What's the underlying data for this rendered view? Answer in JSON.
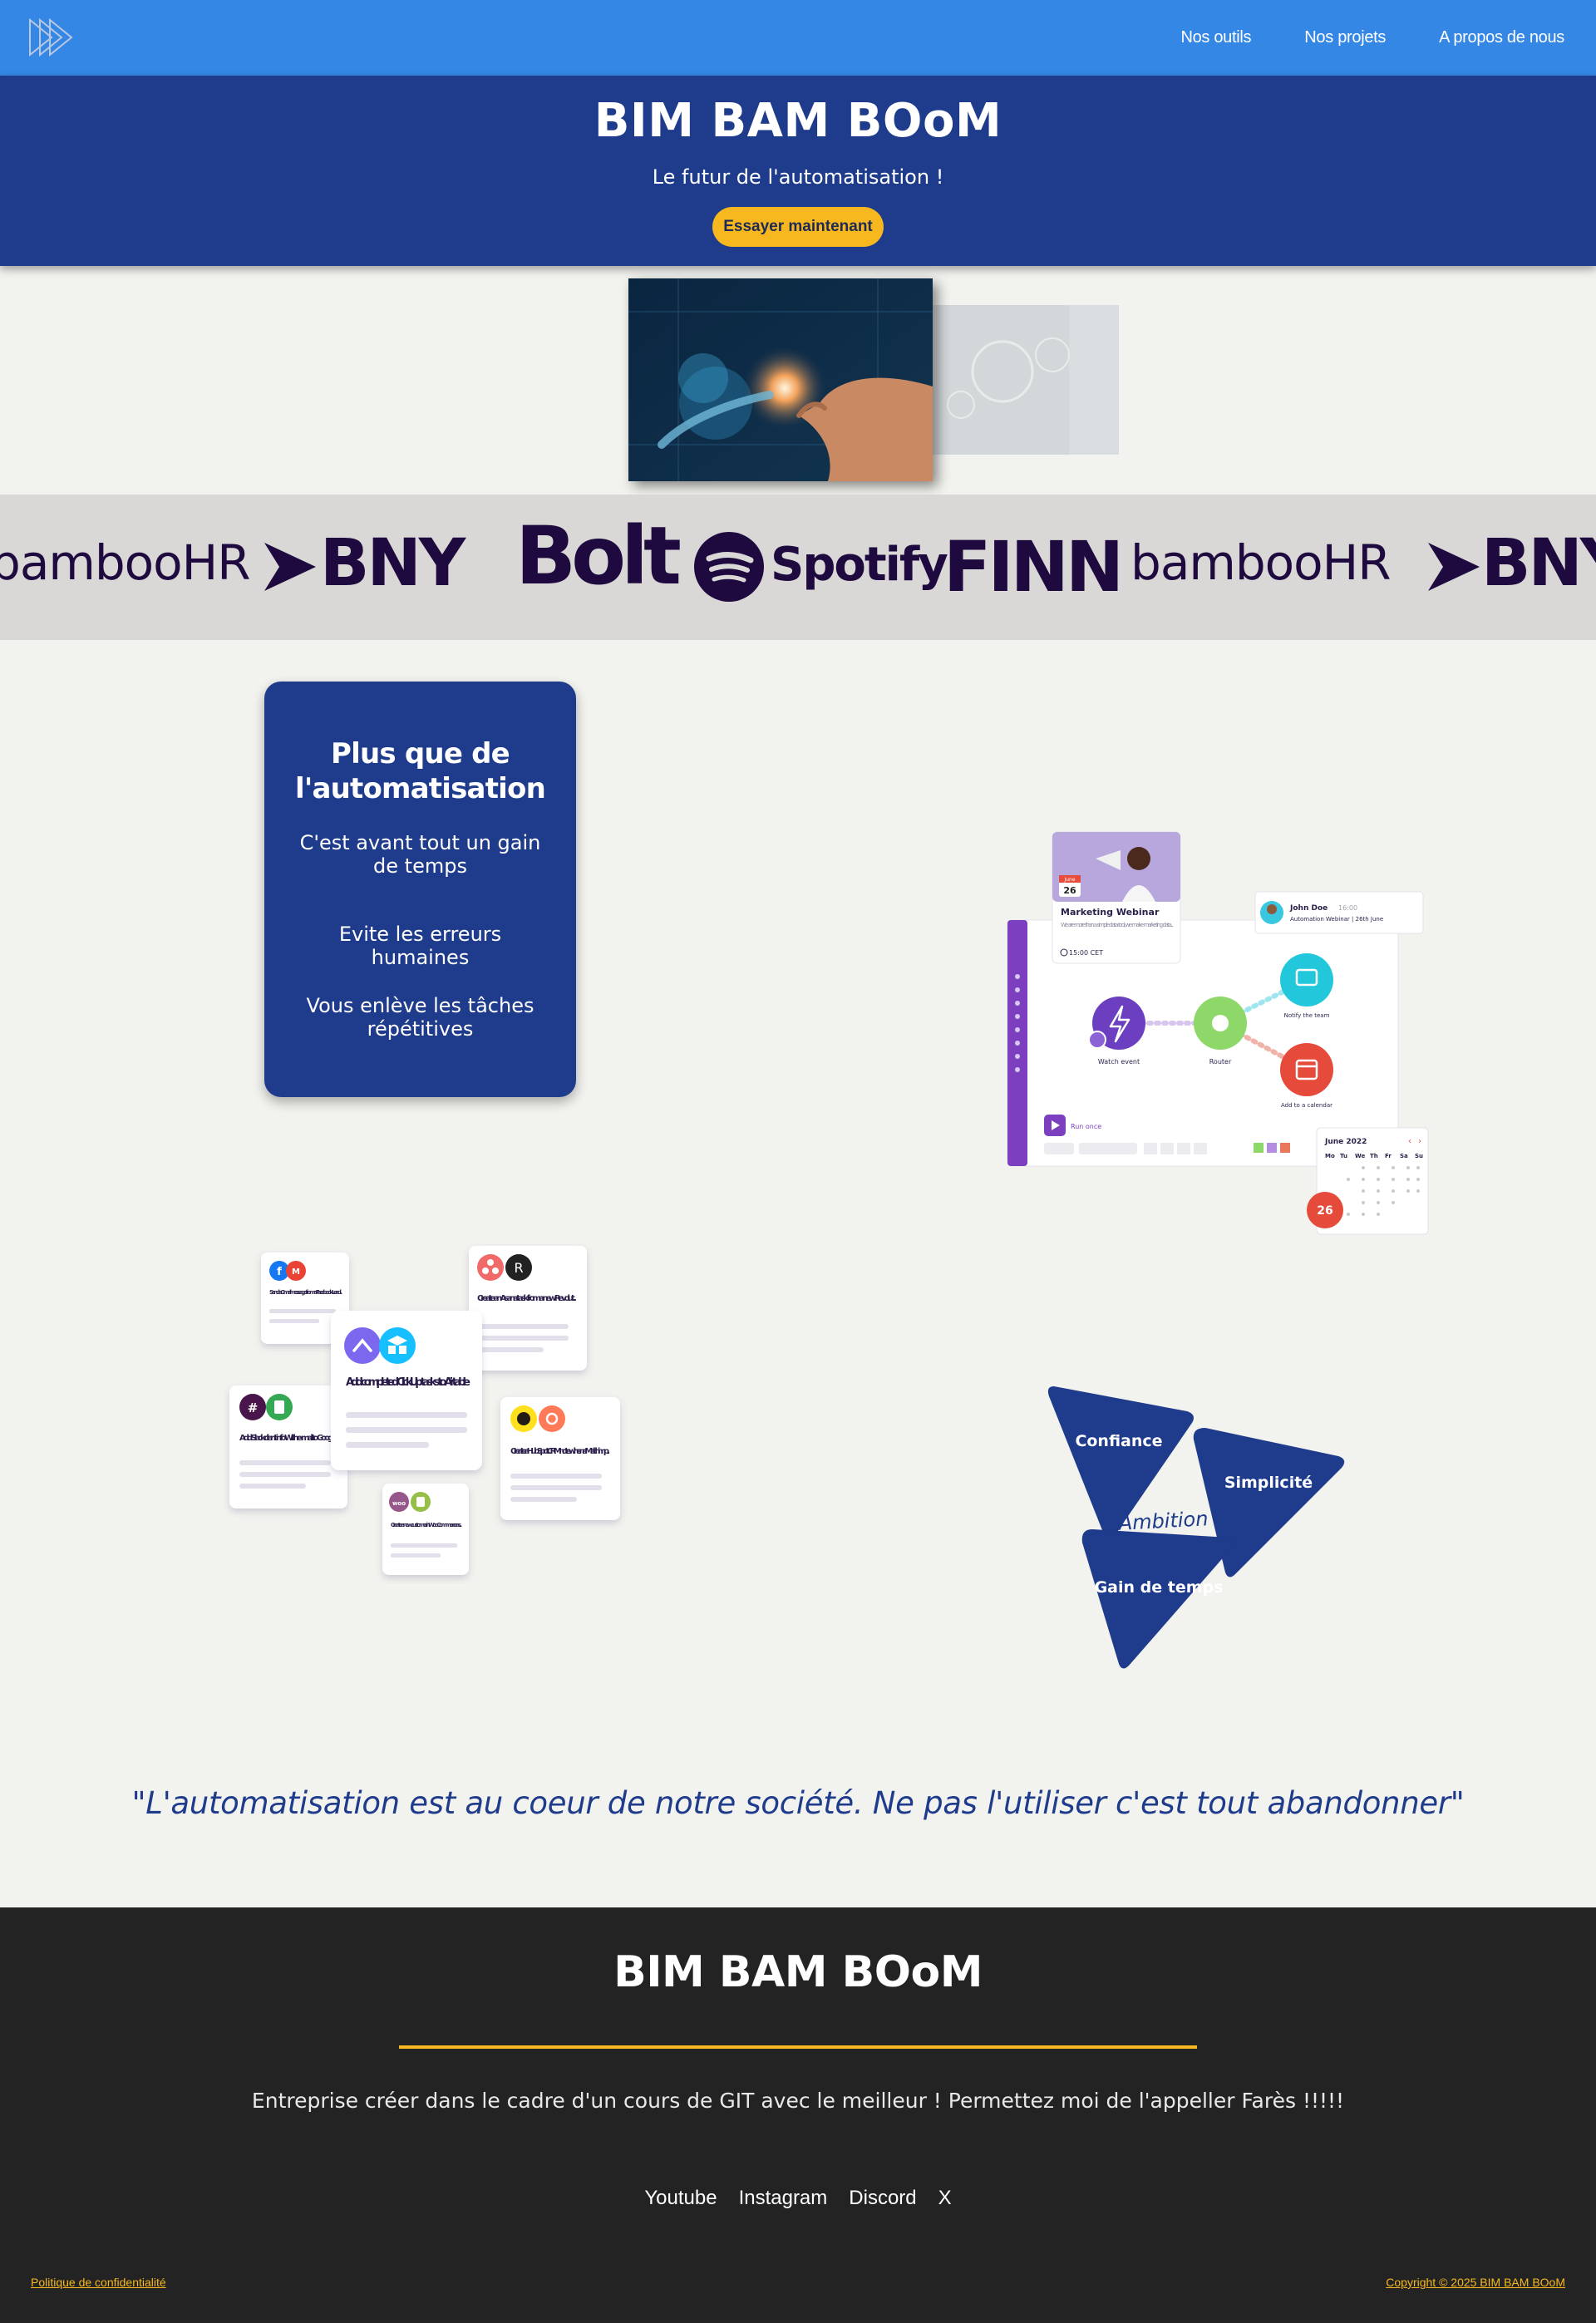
{
  "nav": {
    "links": [
      "Nos outils",
      "Nos projets",
      "A propos de nous"
    ]
  },
  "hero": {
    "title": "BIM BAM BOoM",
    "subtitle": "Le futur de l'automatisation !",
    "cta_label": "Essayer maintenant"
  },
  "brands": [
    "bambooHR",
    "BNY",
    "Bolt",
    "Spotify",
    "FINN"
  ],
  "feature_card": {
    "title": "Plus que de l'automatisation",
    "items": [
      "C'est avant tout un gain de temps",
      "Evite les erreurs humaines",
      "Vous enlève les tâches répétitives"
    ]
  },
  "flow_illustration": {
    "webinar_title": "Marketing Webinar",
    "webinar_text": "We are more than a simple data tool, we make marketing data...",
    "webinar_time": "15:00 CET",
    "webinar_badge_month": "June",
    "webinar_badge_day": "26",
    "contact_name": "John Doe",
    "contact_time": "16:00",
    "contact_detail": "Automation Webinar | 26th June",
    "node_watch": "Watch event",
    "node_router": "Router",
    "node_notify": "Notify the team",
    "node_calendar": "Add to a calendar",
    "run_label": "Run once",
    "calendar_month": "June 2022",
    "calendar_days": [
      "Mo",
      "Tu",
      "We",
      "Th",
      "Fr",
      "Sa",
      "Su"
    ],
    "calendar_selected": "26"
  },
  "cards_illustration": {
    "cards": [
      "Send a Gmail message from a Facebook Lead...",
      "Create an Asana task from a new Revolut...",
      "Add completed ClickUp tasks to Airtable",
      "Add Slack client info With e-mail to Google...",
      "Create a HubSpot CRM note when a Mailchimp...",
      "Create a new customer in WooCommerce as..."
    ]
  },
  "values": {
    "items": [
      "Confiance",
      "Simplicité",
      "Gain de temps"
    ],
    "center": "Ambition",
    "color": "#1e3b8c"
  },
  "quote": "\"L'automatisation est au coeur de notre société. Ne pas l'utiliser c'est tout abandonner\"",
  "footer": {
    "title": "BIM BAM BOoM",
    "description": "Entreprise créer dans le cadre d'un cours de GIT avec le meilleur ! Permettez moi de l'appeller Farès !!!!!",
    "social": [
      "Youtube",
      "Instagram",
      "Discord",
      "X"
    ],
    "privacy": "Politique de confidentialité",
    "copyright": "Copyright © 2025 BIM BAM BOoM"
  },
  "colors": {
    "nav": "#3587e6",
    "hero": "#1e3b8c",
    "accent": "#f7b81f",
    "brand_text": "#1f0a40",
    "footer": "#232323"
  }
}
